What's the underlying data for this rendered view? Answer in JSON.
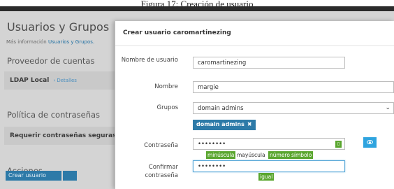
{
  "caption": "Figura 17: Creación de usuario",
  "background": {
    "title": "Usuarios y Grupos",
    "more_info_prefix": "Más información",
    "more_info_link": "Usuarios y Grupos.",
    "account_provider_heading": "Proveedor de cuentas",
    "ldap_label": "LDAP Local",
    "ldap_details": "› Detalles",
    "password_policy_heading": "Política de contraseñas",
    "require_strong_label": "Requerir contraseñas seguras",
    "actions_heading": "Acciones",
    "create_user_button": "Crear usuario"
  },
  "modal": {
    "title": "Crear usuario caromartinezing",
    "username_label": "Nombre de usuario",
    "username_value": "caromartinezing",
    "name_label": "Nombre",
    "name_value": "margie",
    "groups_label": "Grupos",
    "groups_value": "domain admins",
    "group_tag": "domain admins",
    "password_label": "Contraseña",
    "password_value": "••••••••",
    "confirm_label": "Confirmar contraseña",
    "confirm_value": "••••••••",
    "hints": {
      "lowercase": "minúscula",
      "uppercase": "mayúscula",
      "number": "número",
      "symbol": "símbolo",
      "match": "igual"
    }
  },
  "colors": {
    "accent": "#2d7aa8",
    "ok": "#5aa62f",
    "eye_button": "#2fa4df"
  },
  "icons": {
    "select": "chevron-down-icon",
    "tag_remove": "close-icon",
    "password_manager": "key-icon",
    "show_password": "eye-icon"
  }
}
